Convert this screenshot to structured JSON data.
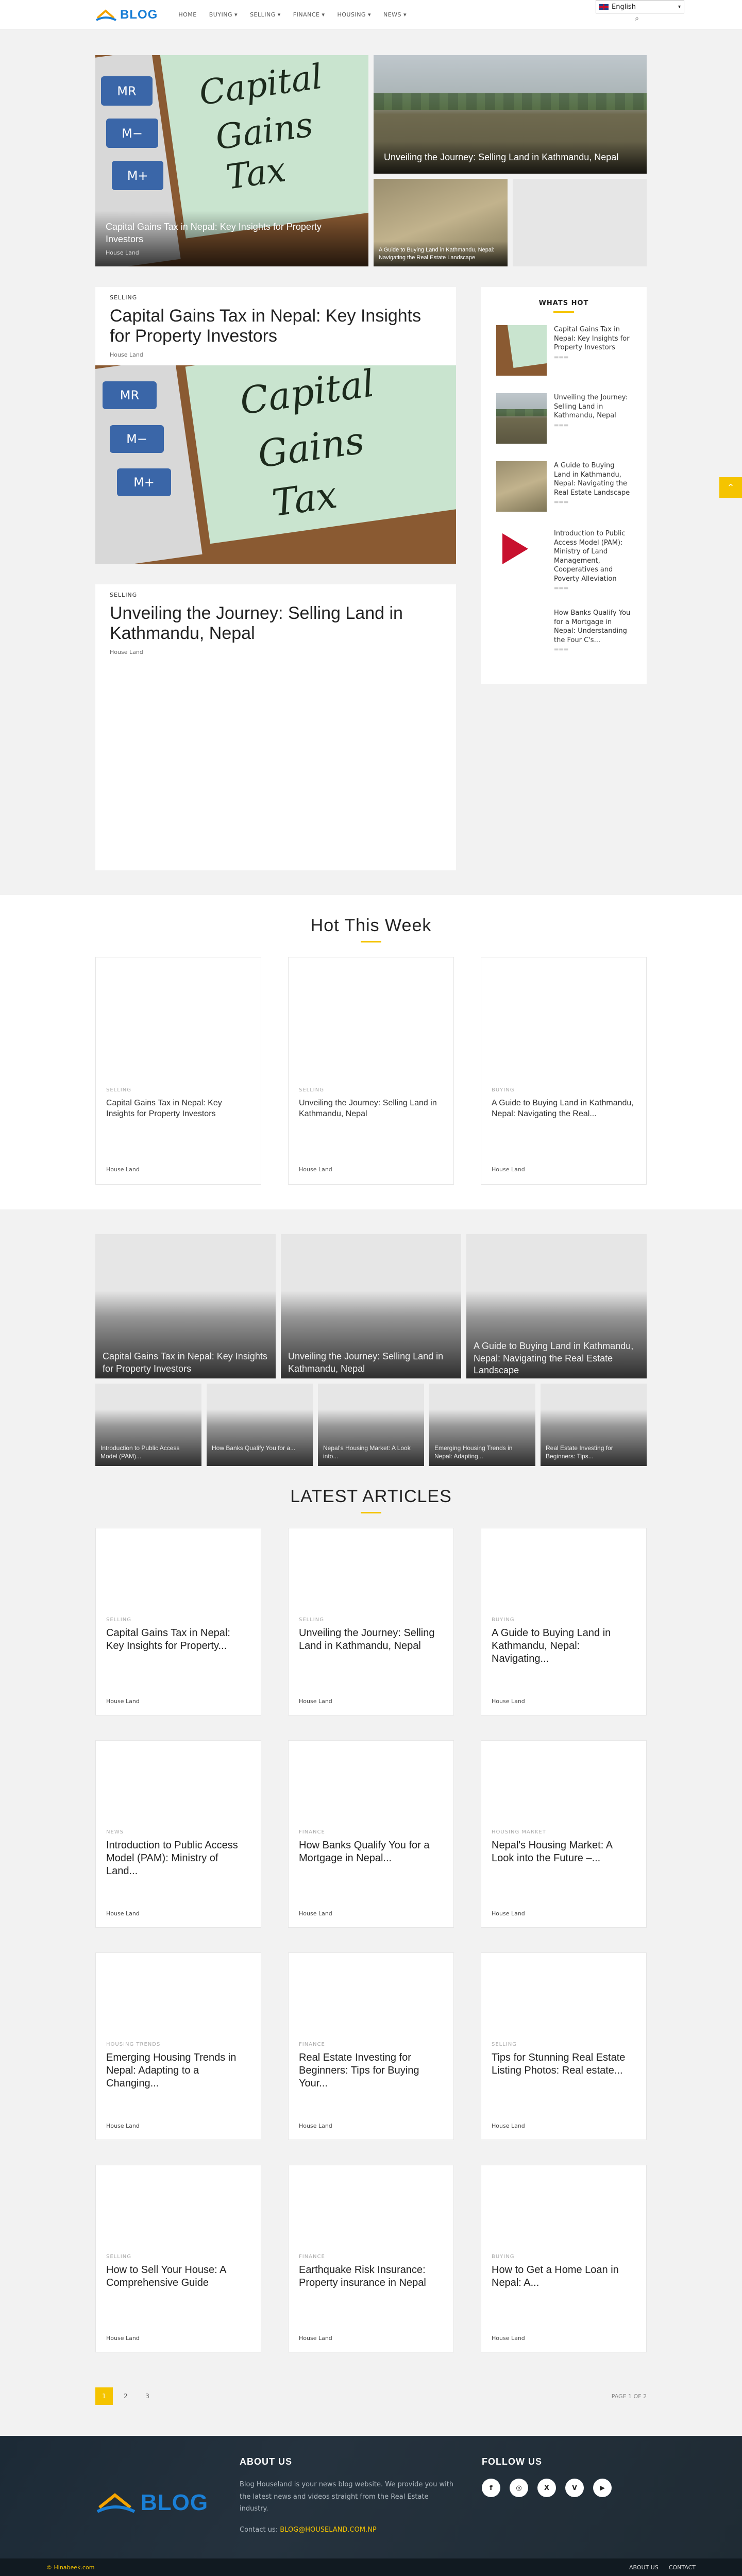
{
  "header": {
    "logo_text": "BLOG",
    "nav": [
      {
        "label": "HOME",
        "has_dropdown": false
      },
      {
        "label": "BUYING",
        "has_dropdown": true
      },
      {
        "label": "SELLING",
        "has_dropdown": true
      },
      {
        "label": "FINANCE",
        "has_dropdown": true
      },
      {
        "label": "HOUSING",
        "has_dropdown": true
      },
      {
        "label": "NEWS",
        "has_dropdown": true
      }
    ],
    "language": "English"
  },
  "featured": {
    "big": {
      "title": "Capital Gains Tax in Nepal: Key Insights for Property Investors",
      "author": "House Land"
    },
    "top_right": {
      "title": "Unveiling the Journey: Selling Land in Kathmandu, Nepal"
    },
    "small_left": {
      "title": "A Guide to Buying Land in Kathmandu, Nepal: Navigating the Real Estate Landscape"
    }
  },
  "main_posts": [
    {
      "category": "SELLING",
      "title": "Capital Gains Tax in Nepal: Key Insights for Property Investors",
      "author": "House Land"
    },
    {
      "category": "SELLING",
      "title": "Unveiling the Journey: Selling Land in Kathmandu, Nepal",
      "author": "House Land"
    }
  ],
  "cgt_image": {
    "word1": "Capital",
    "word2": "Gains",
    "word3": "Tax",
    "key1": "MR",
    "key2": "M−",
    "key3": "M+"
  },
  "sidebar": {
    "title": "WHATS HOT",
    "items": [
      {
        "title": "Capital Gains Tax in Nepal: Key Insights for Property Investors"
      },
      {
        "title": "Unveiling the Journey: Selling Land in Kathmandu, Nepal"
      },
      {
        "title": "A Guide to Buying Land in Kathmandu, Nepal: Navigating the Real Estate Landscape"
      },
      {
        "title": "Introduction to Public Access Model (PAM): Ministry of Land Management, Cooperatives and Poverty Alleviation"
      },
      {
        "title": "How Banks Qualify You for a Mortgage in Nepal: Understanding the Four C's..."
      }
    ]
  },
  "hot_this_week": {
    "title": "Hot This Week",
    "cards": [
      {
        "category": "SELLING",
        "title": "Capital Gains Tax in Nepal: Key Insights for Property Investors",
        "author": "House Land"
      },
      {
        "category": "SELLING",
        "title": "Unveiling the Journey: Selling Land in Kathmandu, Nepal",
        "author": "House Land"
      },
      {
        "category": "BUYING",
        "title": "A Guide to Buying Land in Kathmandu, Nepal: Navigating the Real...",
        "author": "House Land"
      }
    ]
  },
  "mosaic": {
    "big": [
      {
        "title": "Capital Gains Tax in Nepal: Key Insights for Property Investors"
      },
      {
        "title": "Unveiling the Journey: Selling Land in Kathmandu, Nepal"
      },
      {
        "title": "A Guide to Buying Land in Kathmandu, Nepal: Navigating the Real Estate Landscape"
      }
    ],
    "small": [
      {
        "title": "Introduction to Public Access Model (PAM)..."
      },
      {
        "title": "How Banks Qualify You for a..."
      },
      {
        "title": "Nepal's Housing Market: A Look into..."
      },
      {
        "title": "Emerging Housing Trends in Nepal: Adapting..."
      },
      {
        "title": "Real Estate Investing for Beginners: Tips..."
      }
    ]
  },
  "latest": {
    "title": "LATEST ARTICLES",
    "cards": [
      {
        "category": "SELLING",
        "title": "Capital Gains Tax in Nepal: Key Insights for Property...",
        "author": "House Land"
      },
      {
        "category": "SELLING",
        "title": "Unveiling the Journey: Selling Land in Kathmandu, Nepal",
        "author": "House Land"
      },
      {
        "category": "BUYING",
        "title": "A Guide to Buying Land in Kathmandu, Nepal: Navigating...",
        "author": "House Land"
      },
      {
        "category": "NEWS",
        "title": "Introduction to Public Access Model (PAM): Ministry of Land...",
        "author": "House Land"
      },
      {
        "category": "FINANCE",
        "title": "How Banks Qualify You for a Mortgage in Nepal...",
        "author": "House Land"
      },
      {
        "category": "HOUSING MARKET",
        "title": "Nepal's Housing Market: A Look into the Future –...",
        "author": "House Land"
      },
      {
        "category": "HOUSING TRENDS",
        "title": "Emerging Housing Trends in Nepal: Adapting to a Changing...",
        "author": "House Land"
      },
      {
        "category": "FINANCE",
        "title": "Real Estate Investing for Beginners: Tips for Buying Your...",
        "author": "House Land"
      },
      {
        "category": "SELLING",
        "title": "Tips for Stunning Real Estate Listing Photos: Real estate...",
        "author": "House Land"
      },
      {
        "category": "SELLING",
        "title": "How to Sell Your House: A Comprehensive Guide",
        "author": "House Land"
      },
      {
        "category": "FINANCE",
        "title": "Earthquake Risk Insurance: Property insurance in Nepal",
        "author": "House Land"
      },
      {
        "category": "BUYING",
        "title": "How to Get a Home Loan in Nepal: A...",
        "author": "House Land"
      }
    ]
  },
  "pagination": {
    "pages": [
      "1",
      "2",
      "3"
    ],
    "current": "1",
    "info": "PAGE 1 OF 2"
  },
  "footer": {
    "logo_text": "BLOG",
    "about_title": "ABOUT US",
    "about_text": "Blog Houseland is your news blog website. We provide you with the latest news and videos straight from the Real Estate industry.",
    "contact_label": "Contact us:",
    "contact_email": "BLOG@HOUSELAND.COM.NP",
    "follow_title": "FOLLOW US",
    "socials": [
      "f",
      "◎",
      "X",
      "V",
      "▶"
    ],
    "copyright": "© Hinabeek.com",
    "links": [
      "ABOUT US",
      "CONTACT"
    ]
  },
  "colors": {
    "accent": "#f5c400",
    "brand_blue": "#1a7fd6"
  }
}
